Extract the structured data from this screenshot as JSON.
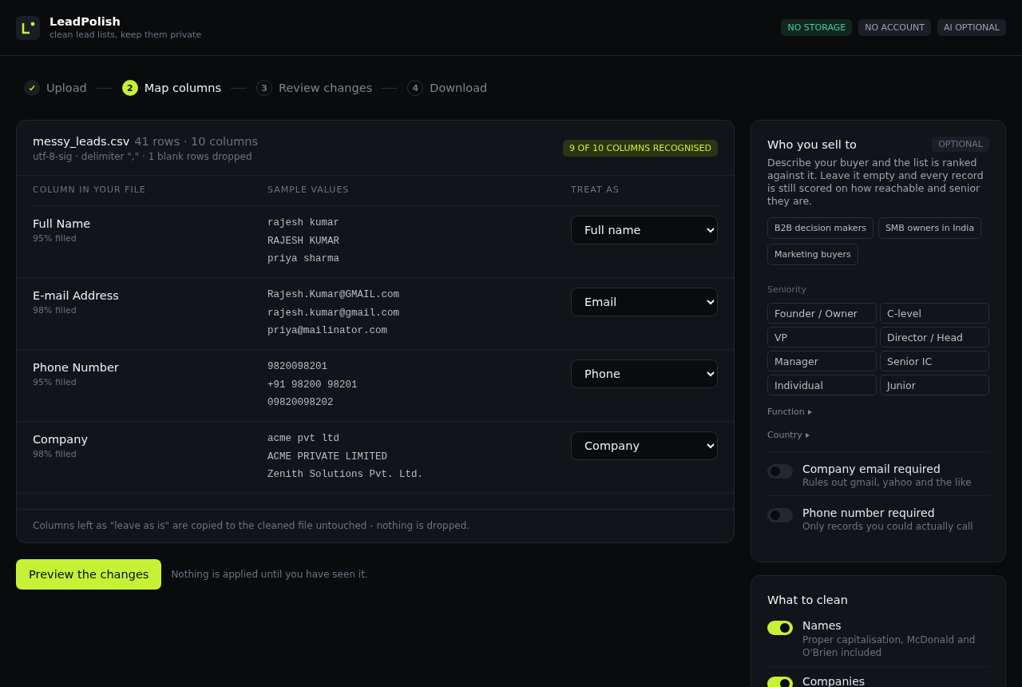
{
  "app": {
    "name": "LeadPolish",
    "tagline": "clean lead lists, keep them private",
    "badges": [
      {
        "label": "NO STORAGE",
        "kind": "positive"
      },
      {
        "label": "NO ACCOUNT",
        "kind": "neutral"
      },
      {
        "label": "AI OPTIONAL",
        "kind": "neutral"
      }
    ]
  },
  "steps": [
    {
      "label": "Upload",
      "done": true,
      "selected": false
    },
    {
      "number": "2",
      "label": "Map columns",
      "done": false,
      "selected": true
    },
    {
      "number": "3",
      "label": "Review changes",
      "done": false,
      "selected": false
    },
    {
      "number": "4",
      "label": "Download",
      "done": false,
      "selected": false
    }
  ],
  "file": {
    "name": "messy_leads.csv",
    "summary": "41 rows · 10 columns",
    "details": "utf-8-sig · delimiter \",\" · 1 blank rows dropped",
    "recognised": "9 OF 10 COLUMNS RECOGNISED"
  },
  "table": {
    "columns": [
      "COLUMN IN YOUR FILE",
      "SAMPLE VALUES",
      "TREAT AS"
    ],
    "rows": [
      {
        "name": "Full Name",
        "filled": "95% filled",
        "samples": [
          "rajesh kumar",
          "RAJESH KUMAR",
          "priya sharma"
        ],
        "treat_as": "Full name"
      },
      {
        "name": "E-mail Address",
        "filled": "98% filled",
        "samples": [
          "Rajesh.Kumar@GMAIL.com",
          "rajesh.kumar@gmail.com",
          "priya@mailinator.com"
        ],
        "treat_as": "Email"
      },
      {
        "name": "Phone Number",
        "filled": "95% filled",
        "samples": [
          "9820098201",
          "+91 98200 98201",
          "09820098202"
        ],
        "treat_as": "Phone"
      },
      {
        "name": "Company",
        "filled": "98% filled",
        "samples": [
          "acme pvt ltd",
          "ACME PRIVATE LIMITED",
          "Zenith Solutions Pvt. Ltd."
        ],
        "treat_as": "Company"
      }
    ],
    "footnote": "Columns left as \"leave as is\" are copied to the cleaned file untouched - nothing is dropped."
  },
  "preview": {
    "button": "Preview the changes",
    "note": "Nothing is applied until you have seen it."
  },
  "audience": {
    "title": "Who you sell to",
    "badge": "OPTIONAL",
    "description": "Describe your buyer and the list is ranked against it. Leave it empty and every record is still scored on how reachable and senior they are.",
    "presets": [
      "B2B decision makers",
      "SMB owners in India",
      "Marketing buyers"
    ],
    "seniority_label": "Seniority",
    "seniority": [
      {
        "label": "Founder / Owner",
        "selected": false
      },
      {
        "label": "C-level",
        "selected": false
      },
      {
        "label": "VP",
        "selected": false
      },
      {
        "label": "Director / Head",
        "selected": false
      },
      {
        "label": "Manager",
        "selected": false
      },
      {
        "label": "Senior IC",
        "selected": false
      },
      {
        "label": "Individual",
        "selected": false
      },
      {
        "label": "Junior",
        "selected": false
      }
    ],
    "filters": [
      {
        "label": "Function",
        "expanded": false
      },
      {
        "label": "Country",
        "expanded": false
      }
    ],
    "toggles": [
      {
        "label": "Company email required",
        "hint": "Rules out gmail, yahoo and the like",
        "on": false
      },
      {
        "label": "Phone number required",
        "hint": "Only records you could actually call",
        "on": false
      }
    ]
  },
  "clean": {
    "title": "What to clean",
    "options": [
      {
        "label": "Names",
        "hint": "Proper capitalisation, McDonald and O'Brien included",
        "on": true
      },
      {
        "label": "Companies",
        "on": true
      }
    ]
  }
}
